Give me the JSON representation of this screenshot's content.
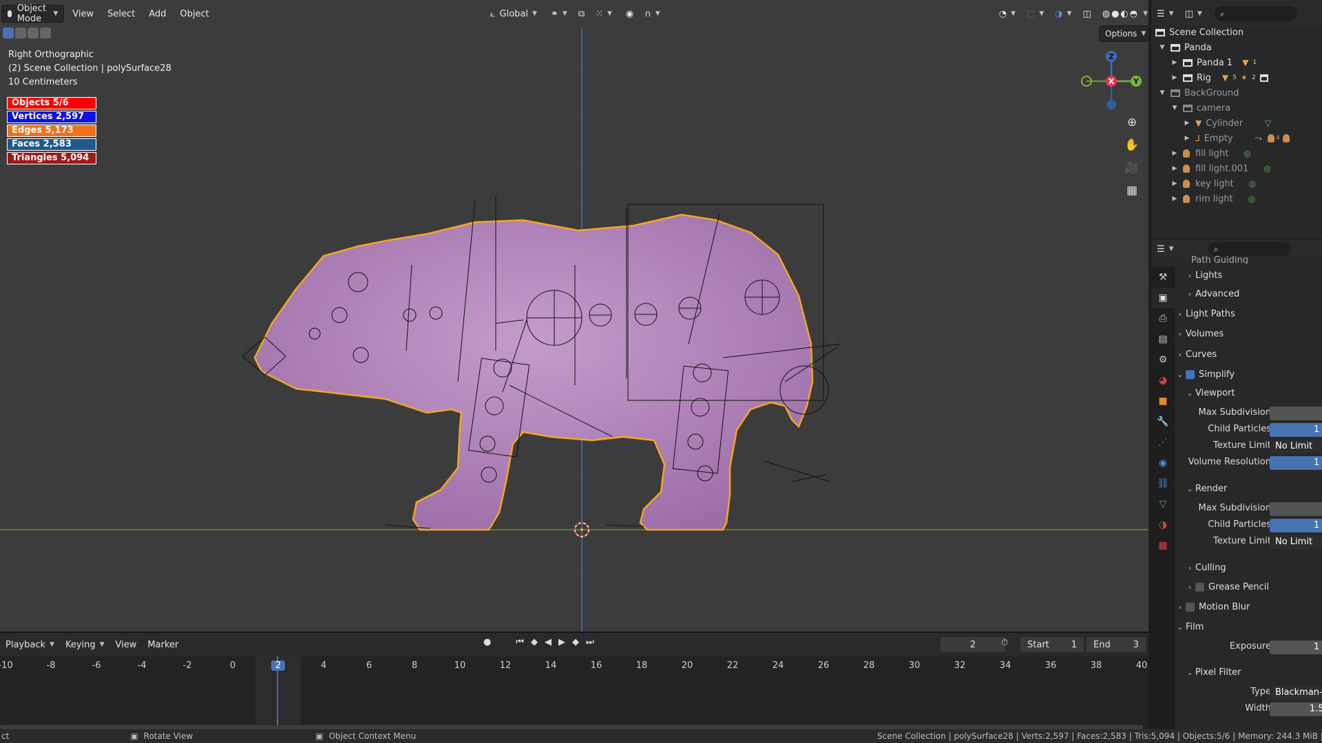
{
  "header": {
    "mode": "Object Mode",
    "menus": [
      "View",
      "Select",
      "Add",
      "Object"
    ],
    "transform_orientation": "Global",
    "options_label": "Options"
  },
  "overlay": {
    "view_name": "Right Orthographic",
    "collection_line": "(2) Scene Collection | polySurface28",
    "scale": "10 Centimeters",
    "stats": [
      {
        "label": "Objects 5/6",
        "color": "#ff0000"
      },
      {
        "label": "Vertices 2,597",
        "color": "#1010e8"
      },
      {
        "label": "Edges 5,173",
        "color": "#f07020"
      },
      {
        "label": "Faces 2,583",
        "color": "#1f5a8c"
      },
      {
        "label": "Triangles 5,094",
        "color": "#a01818"
      }
    ]
  },
  "gizmo": {
    "z": "Z",
    "x": "X",
    "y": "Y"
  },
  "outliner": {
    "rows": [
      {
        "label": "Scene Collection",
        "dim": false
      },
      {
        "label": "Panda",
        "dim": false
      },
      {
        "label": "Panda 1",
        "dim": false
      },
      {
        "label": "Rig",
        "dim": false
      },
      {
        "label": "BackGround",
        "dim": true
      },
      {
        "label": "camera",
        "dim": true
      },
      {
        "label": "Cylinder",
        "dim": true
      },
      {
        "label": "Empty",
        "dim": true
      },
      {
        "label": "fill light",
        "dim": true
      },
      {
        "label": "fill light.001",
        "dim": true
      },
      {
        "label": "key light",
        "dim": true
      },
      {
        "label": "rim light",
        "dim": true
      }
    ],
    "badges": {
      "panda1": "1",
      "rig_a": "5",
      "rig_b": "2",
      "empty": "4"
    }
  },
  "properties": {
    "top_cut": "Path Guiding",
    "lights": "Lights",
    "advanced": "Advanced",
    "light_paths": "Light Paths",
    "volumes": "Volumes",
    "curves": "Curves",
    "simplify": "Simplify",
    "viewport": "Viewport",
    "max_subdivision": "Max Subdivision",
    "child_particles": "Child Particles",
    "texture_limit": "Texture Limit",
    "texture_limit_value": "No Limit",
    "volume_resolution": "Volume Resolution",
    "render": "Render",
    "r_max_subdivision": "Max Subdivision",
    "r_child_particles": "Child Particles",
    "r_texture_limit": "Texture Limit",
    "r_texture_limit_value": "No Limit",
    "culling": "Culling",
    "grease_pencil": "Grease Pencil",
    "motion_blur": "Motion Blur",
    "film": "Film",
    "exposure": "Exposure",
    "pixel_filter": "Pixel Filter",
    "type": "Type",
    "type_value": "Blackman-Harris",
    "width": "Width",
    "val_one": "1",
    "width_value": "1.5"
  },
  "timeline": {
    "menus": [
      "Playback",
      "Keying",
      "View",
      "Marker"
    ],
    "current_frame": "2",
    "start_label": "Start",
    "start_value": "1",
    "end_label": "End",
    "end_value": "3",
    "ticks": [
      "-10",
      "-8",
      "-6",
      "-4",
      "-2",
      "0",
      "2",
      "4",
      "6",
      "8",
      "10",
      "12",
      "14",
      "16",
      "18",
      "20",
      "22",
      "24",
      "26",
      "28",
      "30",
      "32",
      "34",
      "36",
      "38",
      "40"
    ]
  },
  "statusbar": {
    "left_cut": "ct",
    "rotate": "Rotate View",
    "context": "Object Context Menu",
    "info": "Scene Collection | polySurface28 | Verts:2,597 | Faces:2,583 | Tris:5,094 | Objects:5/6 | Memory: 244.3 MiB | VRAM:"
  },
  "colors": {
    "accent": "#4772b3",
    "selection": "#f5a623",
    "body": "#a77ab0"
  }
}
